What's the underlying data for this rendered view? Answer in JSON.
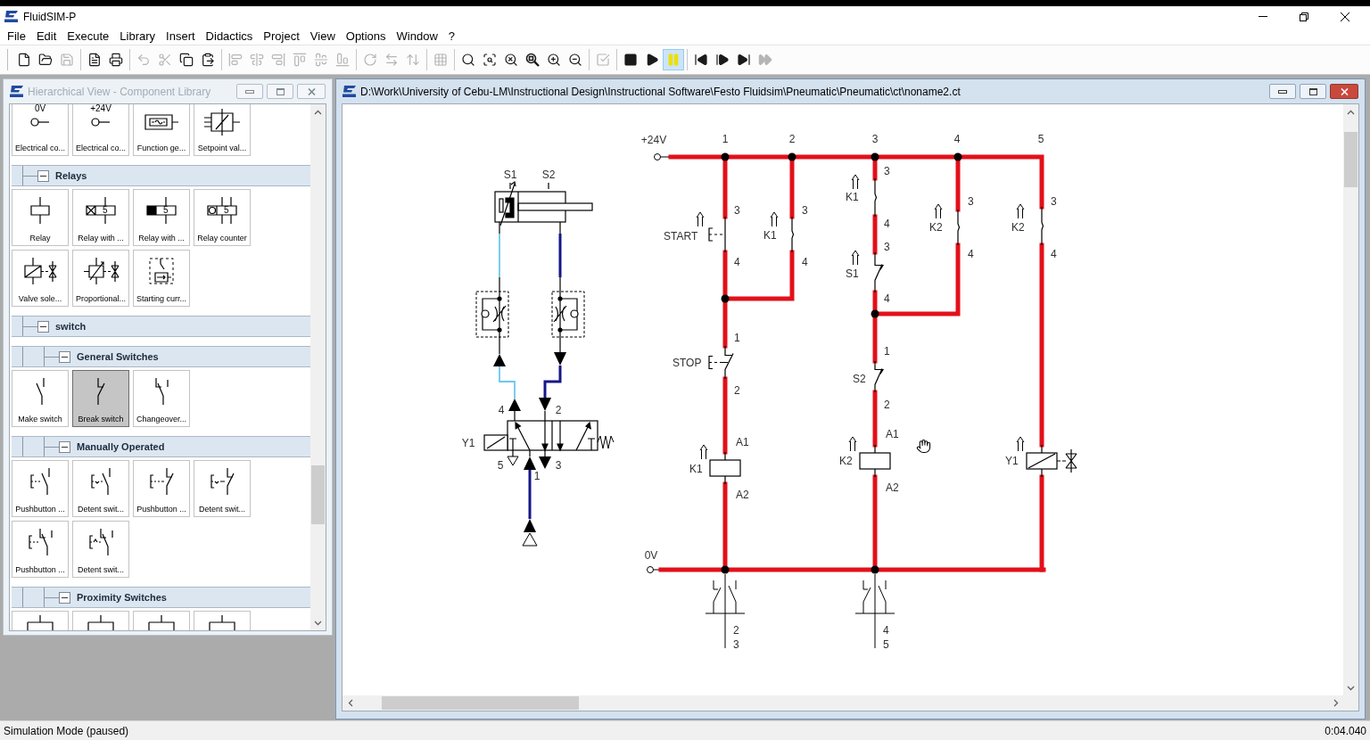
{
  "app": {
    "title": "FluidSIM-P"
  },
  "menu": [
    "File",
    "Edit",
    "Execute",
    "Library",
    "Insert",
    "Didactics",
    "Project",
    "View",
    "Options",
    "Window",
    "?"
  ],
  "toolbar": [
    {
      "buttons": [
        {
          "kind": "new",
          "disabled": false
        },
        {
          "kind": "open",
          "disabled": false
        },
        {
          "kind": "save",
          "disabled": true
        }
      ]
    },
    {
      "buttons": [
        {
          "kind": "print_preview",
          "disabled": false
        },
        {
          "kind": "print",
          "disabled": false
        }
      ]
    },
    {
      "buttons": [
        {
          "kind": "undo",
          "disabled": true
        },
        {
          "kind": "cut",
          "disabled": true
        },
        {
          "kind": "copy",
          "disabled": false
        },
        {
          "kind": "paste",
          "disabled": false
        }
      ]
    },
    {
      "buttons": [
        {
          "kind": "align_left",
          "disabled": true
        },
        {
          "kind": "align_center",
          "disabled": true
        },
        {
          "kind": "align_right",
          "disabled": true
        },
        {
          "kind": "align_top",
          "disabled": true
        },
        {
          "kind": "align_middle",
          "disabled": true
        },
        {
          "kind": "align_bottom",
          "disabled": true
        }
      ]
    },
    {
      "buttons": [
        {
          "kind": "rotate",
          "disabled": true
        },
        {
          "kind": "flip_horizontal",
          "disabled": true
        },
        {
          "kind": "flip_vertical",
          "disabled": true
        }
      ]
    },
    {
      "buttons": [
        {
          "kind": "grid",
          "disabled": true
        }
      ]
    },
    {
      "buttons": [
        {
          "kind": "zoom_actual",
          "disabled": false
        },
        {
          "kind": "zoom_fit",
          "disabled": false
        },
        {
          "kind": "zoom_all",
          "disabled": false
        },
        {
          "kind": "zoom_window",
          "disabled": false
        },
        {
          "kind": "zoom_in",
          "disabled": false
        },
        {
          "kind": "zoom_out",
          "disabled": false
        }
      ]
    },
    {
      "buttons": [
        {
          "kind": "check",
          "disabled": true
        }
      ]
    },
    {
      "buttons": [
        {
          "kind": "stop",
          "disabled": false,
          "pressed": false
        },
        {
          "kind": "play",
          "disabled": false,
          "pressed": false
        },
        {
          "kind": "pause",
          "disabled": false,
          "pressed": true
        }
      ]
    },
    {
      "buttons": [
        {
          "kind": "reset",
          "disabled": false
        },
        {
          "kind": "step",
          "disabled": false
        },
        {
          "kind": "next",
          "disabled": false
        },
        {
          "kind": "end",
          "disabled": true
        }
      ]
    }
  ],
  "library_window": {
    "title": "Hierarchical View - Component Library",
    "active": false,
    "items": [
      {
        "kind": "tiles",
        "tiles": [
          {
            "kind": "terminal",
            "symbol_text": "0V",
            "label": "Electrical co...",
            "selected": false
          },
          {
            "kind": "terminal",
            "symbol_text": "+24V",
            "label": "Electrical co...",
            "selected": false
          },
          {
            "kind": "function_generator",
            "label": "Function ge...",
            "selected": false
          },
          {
            "kind": "setpoint",
            "label": "Setpoint val...",
            "selected": false
          }
        ]
      },
      {
        "kind": "group",
        "label": "Relays",
        "expanded": true,
        "children": [
          {
            "kind": "tiles",
            "tiles": [
              {
                "kind": "relay",
                "label": "Relay",
                "selected": false
              },
              {
                "kind": "relay_on_delay",
                "symbol_text": "5",
                "label": "Relay with ...",
                "selected": false
              },
              {
                "kind": "relay_off_delay",
                "symbol_text": "5",
                "label": "Relay with ...",
                "selected": false
              },
              {
                "kind": "relay_counter",
                "symbol_text": "5",
                "label": "Relay counter",
                "selected": false
              },
              {
                "kind": "valve_solenoid",
                "label": "Valve sole...",
                "selected": false
              },
              {
                "kind": "proportional_solenoid",
                "label": "Proportional...",
                "selected": false
              },
              {
                "kind": "starting_current",
                "label": "Starting curr...",
                "selected": false
              }
            ]
          }
        ]
      },
      {
        "kind": "group",
        "label": "switch",
        "expanded": true,
        "children": [
          {
            "kind": "group",
            "label": "General Switches",
            "expanded": true,
            "children": [
              {
                "kind": "tiles",
                "tiles": [
                  {
                    "kind": "make",
                    "label": "Make switch",
                    "selected": false
                  },
                  {
                    "kind": "break",
                    "label": "Break switch",
                    "selected": true
                  },
                  {
                    "kind": "changeover",
                    "label": "Changeover...",
                    "selected": false
                  }
                ]
              }
            ]
          },
          {
            "kind": "group",
            "label": "Manually Operated",
            "expanded": true,
            "children": [
              {
                "kind": "tiles",
                "tiles": [
                  {
                    "kind": "pushbutton_make",
                    "label": "Pushbutton ...",
                    "selected": false
                  },
                  {
                    "kind": "detent_make",
                    "label": "Detent swit...",
                    "selected": false
                  },
                  {
                    "kind": "pushbutton_break",
                    "label": "Pushbutton ...",
                    "selected": false
                  },
                  {
                    "kind": "detent_break",
                    "label": "Detent swit...",
                    "selected": false
                  },
                  {
                    "kind": "pushbutton_changeover",
                    "label": "Pushbutton ...",
                    "selected": false
                  },
                  {
                    "kind": "detent_changeover",
                    "label": "Detent swit...",
                    "selected": false
                  }
                ]
              }
            ]
          },
          {
            "kind": "group",
            "label": "Proximity Switches",
            "expanded": true,
            "children": [
              {
                "kind": "tiles",
                "tiles": [
                  {
                    "kind": "proximity",
                    "selected": false
                  },
                  {
                    "kind": "proximity",
                    "selected": false
                  },
                  {
                    "kind": "proximity",
                    "selected": false
                  },
                  {
                    "kind": "proximity",
                    "selected": false
                  }
                ]
              }
            ]
          }
        ]
      }
    ]
  },
  "document_window": {
    "title": "D:\\Work\\University of Cebu-LM\\Instructional Design\\Instructional Software\\Festo Fluidsim\\Pneumatic\\Pneumatic\\ct\\noname2.ct",
    "active": true
  },
  "pneumatic_circuit": {
    "cylinder": {
      "sensors": [
        "S1",
        "S2"
      ]
    },
    "valve": {
      "solenoid": "Y1",
      "ports": [
        "4",
        "2",
        "5",
        "3",
        "1"
      ]
    },
    "lines": [
      {
        "pressurized": false
      },
      {
        "pressurized": true
      },
      {
        "pressurized": true
      }
    ]
  },
  "electrical_circuit": {
    "energized": true,
    "supply": [
      "+24V",
      "0V"
    ],
    "current_paths": [
      "1",
      "2",
      "3",
      "4",
      "5"
    ],
    "components": [
      {
        "kind": "pushbutton_make",
        "label": "START",
        "terminals": [
          "3",
          "4"
        ]
      },
      {
        "kind": "relay_make",
        "label": "K1",
        "terminals": [
          "3",
          "4"
        ]
      },
      {
        "kind": "pushbutton_break",
        "label": "STOP",
        "terminals": [
          "1",
          "2"
        ]
      },
      {
        "kind": "coil",
        "label": "K1",
        "terminals": [
          "A1",
          "A2"
        ]
      },
      {
        "kind": "relay_make",
        "label": "K1",
        "terminals": [
          "3",
          "4"
        ]
      },
      {
        "kind": "sensor_break",
        "label": "S1",
        "terminals": [
          "3",
          "4"
        ]
      },
      {
        "kind": "relay_make",
        "label": "K2",
        "terminals": [
          "3",
          "4"
        ]
      },
      {
        "kind": "sensor_break",
        "label": "S2",
        "terminals": [
          "1",
          "2"
        ]
      },
      {
        "kind": "coil",
        "label": "K2",
        "terminals": [
          "A1",
          "A2"
        ]
      },
      {
        "kind": "relay_make",
        "label": "K2",
        "terminals": [
          "3",
          "4"
        ]
      },
      {
        "kind": "solenoid",
        "label": "Y1"
      }
    ],
    "contact_tables": [
      [
        "2",
        "3"
      ],
      [
        "4",
        "5"
      ]
    ]
  },
  "status_bar": {
    "mode": "Simulation Mode (paused)",
    "time": "0:04.040"
  }
}
